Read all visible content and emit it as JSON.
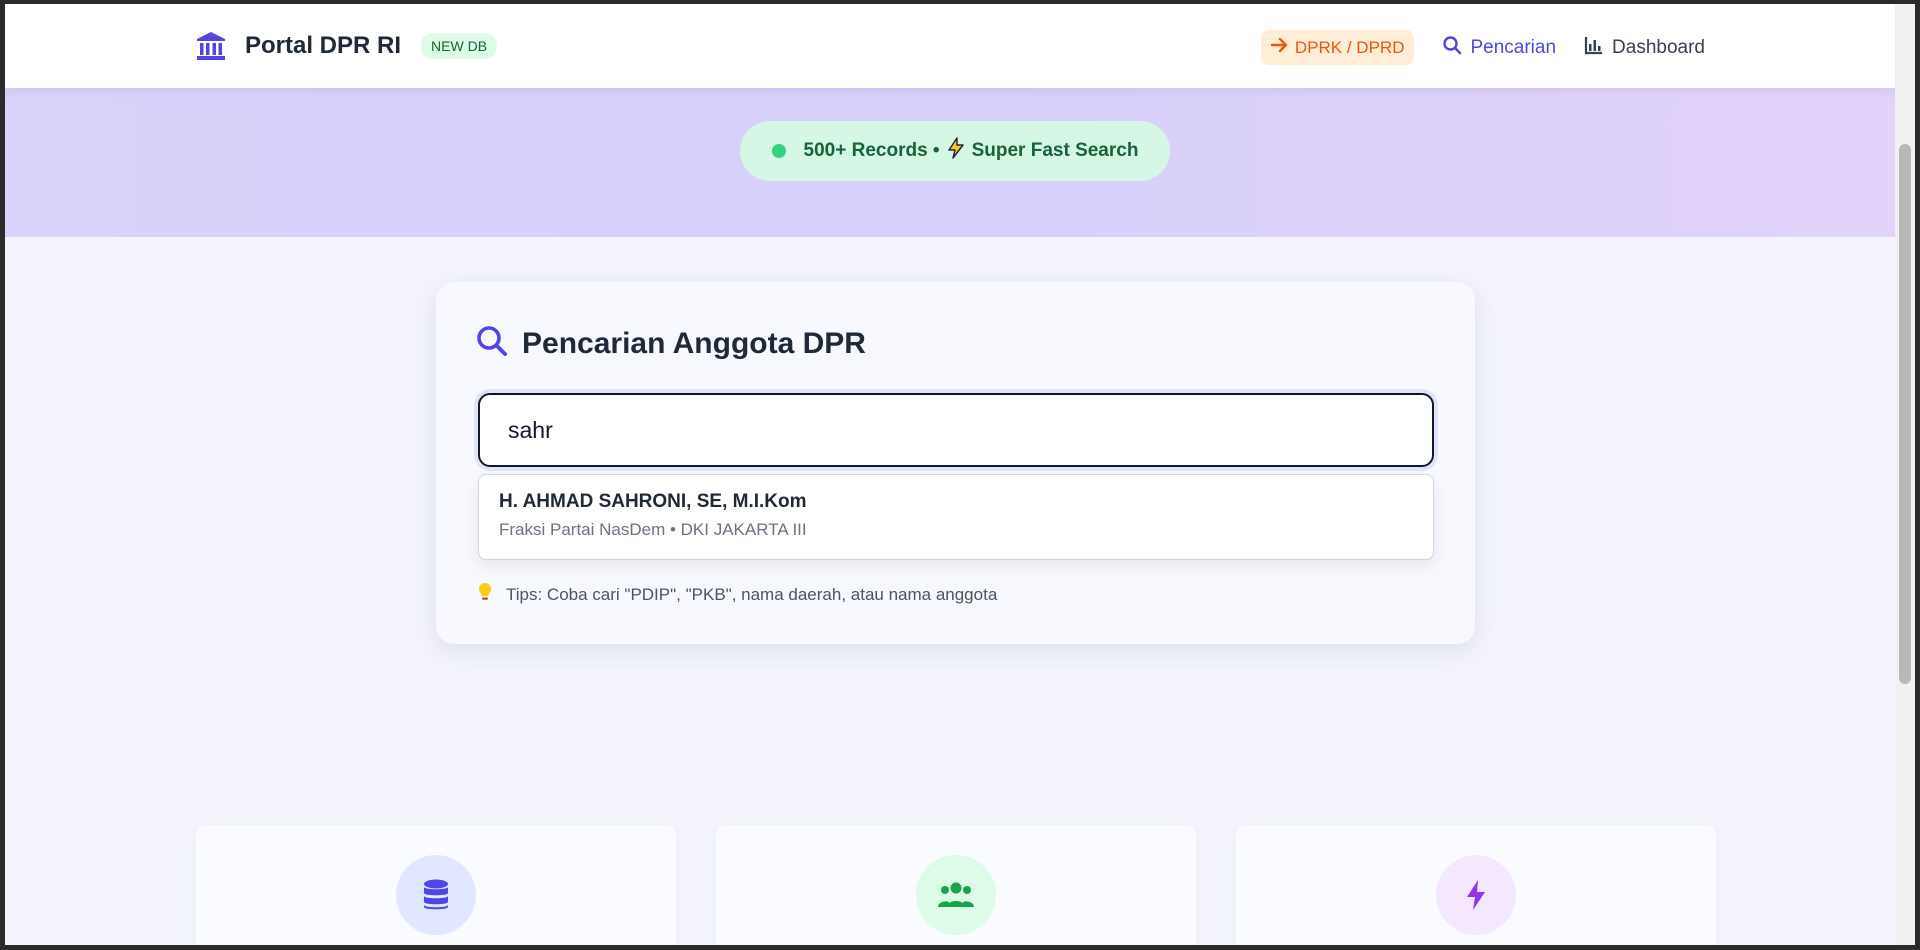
{
  "navbar": {
    "brand_title": "Portal DPR RI",
    "badge": "NEW DB",
    "links": {
      "dprk": "DPRK / DPRD",
      "search": "Pencarian",
      "dashboard": "Dashboard"
    }
  },
  "hero": {
    "status_records": "500+ Records •",
    "status_speed": "Super Fast Search"
  },
  "search_card": {
    "title": "Pencarian Anggota DPR",
    "input_value": "sahr",
    "suggestions": [
      {
        "name": "H. AHMAD SAHRONI, SE, M.I.Kom",
        "meta": "Fraksi Partai NasDem • DKI JAKARTA III"
      }
    ],
    "tips": "Tips: Coba cari \"PDIP\", \"PKB\", nama daerah, atau nama anggota"
  },
  "feature_cards": [
    {
      "icon": "database-icon",
      "color": "#4f46e5",
      "bg": "#e0e7ff"
    },
    {
      "icon": "users-icon",
      "color": "#16a34a",
      "bg": "#dcfce7"
    },
    {
      "icon": "bolt-icon",
      "color": "#9333ea",
      "bg": "#f3e8ff"
    }
  ],
  "colors": {
    "accent": "#4f46e5",
    "orange": "#ea580c",
    "green": "#16a34a"
  }
}
